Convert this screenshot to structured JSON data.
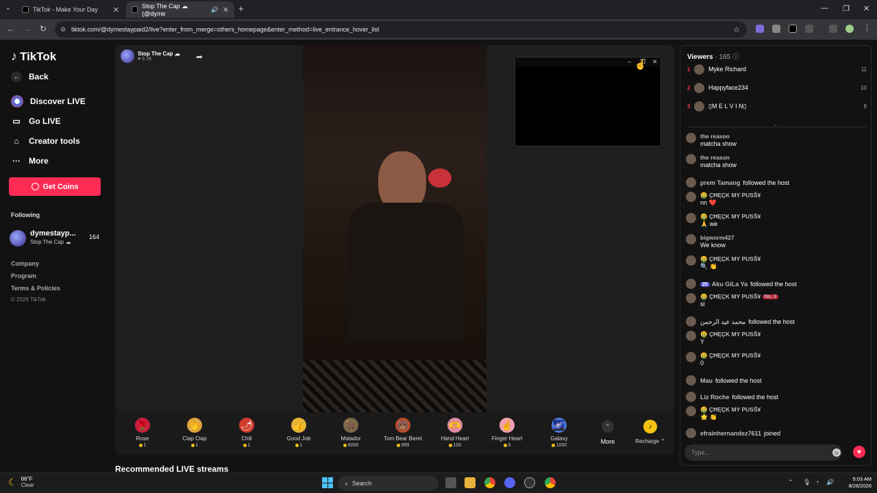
{
  "browser": {
    "tabs": [
      {
        "title": "TikTok - Make Your Day",
        "active": false
      },
      {
        "title": "Stop The Cap ☁ (@dyme",
        "active": true
      }
    ],
    "url": "tiktok.com/@dymestaypaid2/live?enter_from_merge=others_homepage&enter_method=live_entrance_hover_list"
  },
  "sidebar": {
    "logo": "TikTok",
    "back_label": "Back",
    "nav": [
      {
        "label": "Discover LIVE",
        "icon": "live-globe-icon"
      },
      {
        "label": "Go LIVE",
        "icon": "camera-icon"
      },
      {
        "label": "Creator tools",
        "icon": "home-icon"
      },
      {
        "label": "More",
        "icon": "ellipsis-icon"
      }
    ],
    "get_coins": "Get Coins",
    "following_heading": "Following",
    "following": {
      "name": "dymestayp...",
      "sub": "Stop The Cap ☁",
      "count": "164"
    },
    "footer": [
      "Company",
      "Program",
      "Terms & Policies"
    ],
    "copyright": "© 2026 TikTok"
  },
  "stream": {
    "host_name": "Stop The Cap ☁",
    "likes": "♥ 3.7K"
  },
  "gifts": [
    {
      "name": "Rose",
      "price": "1",
      "icon": "🌹",
      "color": "#c81e3c"
    },
    {
      "name": "Clap Clap",
      "price": "1",
      "icon": "👏",
      "color": "#e0a23a"
    },
    {
      "name": "Chili",
      "price": "1",
      "icon": "🌶",
      "color": "#d23a2a"
    },
    {
      "name": "Good Job",
      "price": "1",
      "icon": "👍",
      "color": "#e6b23a"
    },
    {
      "name": "Matador",
      "price": "6000",
      "icon": "🐂",
      "color": "#7a6a4a"
    },
    {
      "name": "Tom Bear Beret",
      "price": "999",
      "icon": "🐻",
      "color": "#c04a2a"
    },
    {
      "name": "Hand Heart",
      "price": "100",
      "icon": "🫶",
      "color": "#e08aa0"
    },
    {
      "name": "Finger Heart",
      "price": "5",
      "icon": "🤞",
      "color": "#f0a0b0"
    },
    {
      "name": "Galaxy",
      "price": "1000",
      "icon": "🌌",
      "color": "#4a7ae0"
    }
  ],
  "gift_more_label": "More",
  "recharge_label": "Recharge ⌃",
  "recommended_heading": "Recommended LIVE streams",
  "viewers": {
    "heading": "Viewers",
    "count": "· 165",
    "top": [
      {
        "rank": "1",
        "name": "Myke Richard",
        "score": "11"
      },
      {
        "rank": "2",
        "name": "Happyface234",
        "score": "10"
      },
      {
        "rank": "3",
        "name": "▯M E L V I N▯",
        "score": "9"
      }
    ]
  },
  "chat": [
    {
      "user": "the reason",
      "text": "matcha show",
      "type": "msg"
    },
    {
      "user": "the reason",
      "text": "matcha show",
      "type": "msg"
    },
    {
      "user": "prem Tamang",
      "text": "followed the host",
      "type": "event"
    },
    {
      "user": "🤮 ÇĦĘÇK MY PUSŠ¥",
      "text": "nn ❤️",
      "type": "msg"
    },
    {
      "user": "🤮 ÇĦĘÇK MY PUSŠ¥",
      "text": "🙏 we",
      "type": "msg"
    },
    {
      "user": "bigworm427",
      "text": "We know",
      "type": "msg"
    },
    {
      "user": "🤮 ÇĦĘÇK MY PUSŠ¥",
      "text": "🔍 👏",
      "type": "msg"
    },
    {
      "user": "Aku GiLa Ya",
      "badge": "20",
      "text": "followed the host",
      "type": "event"
    },
    {
      "user": "🤮 ÇĦĘÇK MY PUSŠ¥",
      "badge2": "No. 3",
      "text": "sl",
      "type": "msg"
    },
    {
      "user": "محمد عبد الرحمن",
      "text": "followed the host",
      "type": "event"
    },
    {
      "user": "🤮 ÇĦĘÇK MY PUSŠ¥",
      "text": "Y",
      "type": "msg"
    },
    {
      "user": "🤮 ÇĦĘÇK MY PUSŠ¥",
      "text": "0",
      "type": "msg"
    },
    {
      "user": "Mau",
      "text": "followed the host",
      "type": "event"
    },
    {
      "user": "Liz Roche",
      "text": "followed the host",
      "type": "event"
    },
    {
      "user": "🤮 ÇĦĘÇK MY PUSŠ¥",
      "text": "🌟 👏",
      "type": "msg"
    },
    {
      "user": "efrainhernandez7611",
      "text": "joined",
      "type": "event"
    }
  ],
  "chat_placeholder": "Type...",
  "taskbar": {
    "weather_temp": "66°F",
    "weather_cond": "Clear",
    "search_label": "Search",
    "time": "5:03 AM",
    "date": "8/26/2026"
  },
  "colors": {
    "accent": "#fe2c55",
    "coin": "#f5c211",
    "rank": "#fe2c55"
  }
}
